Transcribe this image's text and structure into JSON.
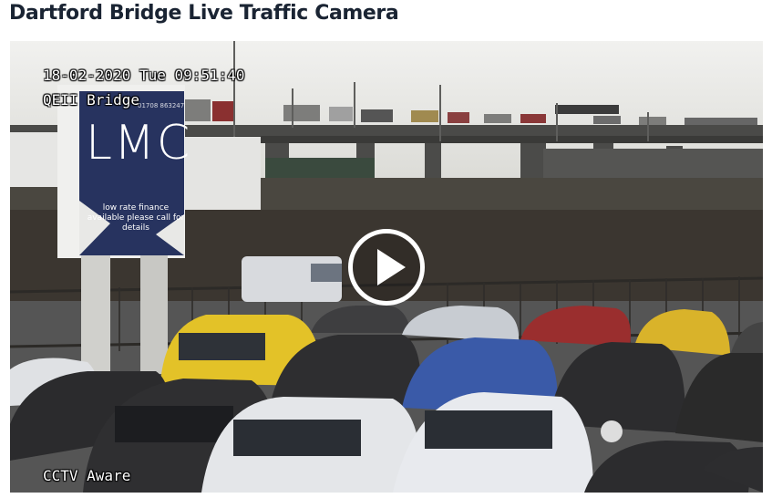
{
  "page": {
    "title": "Dartford Bridge Live Traffic Camera"
  },
  "player": {
    "overlay_datetime": "18-02-2020 Tue 09:51:40",
    "overlay_location": "QEII Bridge",
    "overlay_watermark": "CCTV Aware",
    "play_icon": "play-icon"
  },
  "billboard": {
    "logo": "LMC",
    "phone": "01708 863247",
    "tagline": "low rate finance available please call for details"
  },
  "colors": {
    "title": "#1a2433",
    "sign_blue": "#27335f",
    "overlay_text": "#ffffff"
  }
}
